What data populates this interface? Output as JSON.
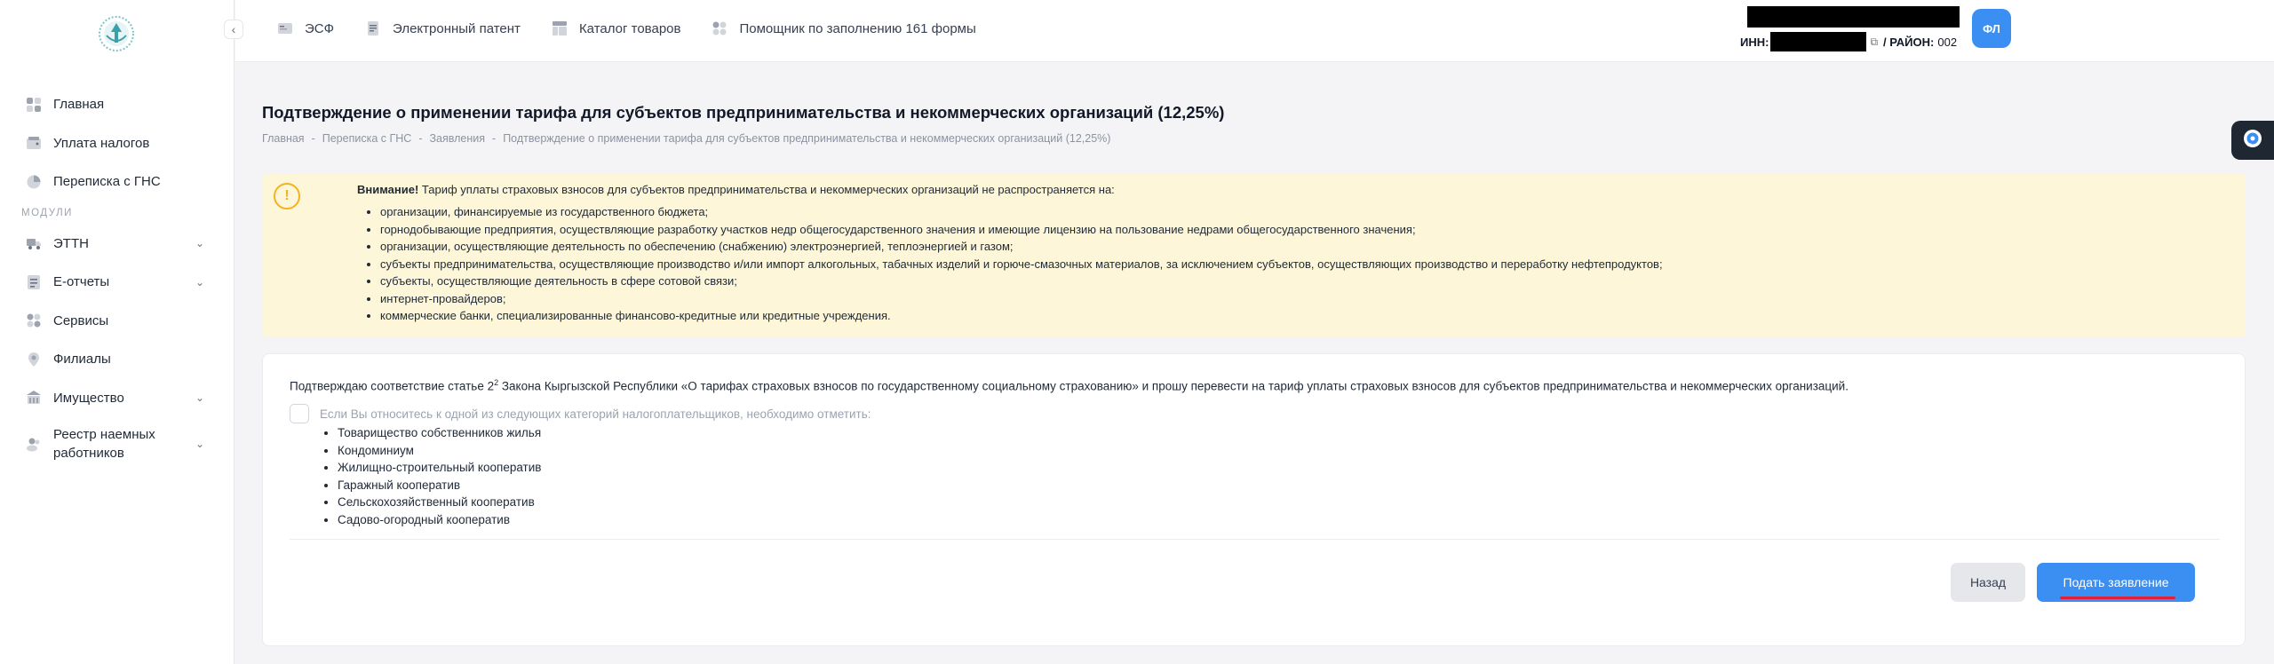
{
  "sidebar": {
    "collapse_glyph": "‹",
    "items": [
      {
        "label": "Главная",
        "icon": "home-icon"
      },
      {
        "label": "Уплата налогов",
        "icon": "wallet-icon"
      },
      {
        "label": "Переписка с ГНС",
        "icon": "chat-icon"
      }
    ],
    "section_label": "МОДУЛИ",
    "modules": [
      {
        "label": "ЭТТН",
        "icon": "truck-icon",
        "expandable": true
      },
      {
        "label": "Е-отчеты",
        "icon": "report-icon",
        "expandable": true
      },
      {
        "label": "Сервисы",
        "icon": "grid-icon",
        "expandable": false
      },
      {
        "label": "Филиалы",
        "icon": "pin-icon",
        "expandable": false
      },
      {
        "label": "Имущество",
        "icon": "building-icon",
        "expandable": true
      },
      {
        "label": "Реестр наемных работников",
        "icon": "people-icon",
        "expandable": true
      }
    ]
  },
  "topbar": {
    "links": [
      {
        "label": "ЭСФ",
        "icon": "invoice-icon"
      },
      {
        "label": "Электронный патент",
        "icon": "document-icon"
      },
      {
        "label": "Каталог товаров",
        "icon": "catalog-icon"
      },
      {
        "label": "Помощник по заполнению 161 формы",
        "icon": "helper-icon"
      }
    ],
    "inn_label": "ИНН:",
    "district_label": "/ РАЙОН:",
    "district_value": "002",
    "avatar_text": "ФЛ"
  },
  "page": {
    "title": "Подтверждение о применении тарифа для субъектов предпринимательства и некоммерческих организаций (12,25%)",
    "breadcrumb": [
      "Главная",
      "Переписка с ГНС",
      "Заявления",
      "Подтверждение о применении тарифа для субъектов предпринимательства и некоммерческих организаций (12,25%)"
    ],
    "breadcrumb_sep": "-"
  },
  "warning": {
    "bold": "Внимание!",
    "text": " Тариф уплаты страховых взносов для субъектов предпринимательства и некоммерческих организаций не распространяется на:",
    "items": [
      "организации, финансируемые из государственного бюджета;",
      "горнодобывающие предприятия, осуществляющие разработку участков недр общегосударственного значения и имеющие лицензию на пользование недрами общегосударственного значения;",
      "организации, осуществляющие деятельность по обеспечению (снабжению) электроэнергией, теплоэнергией и газом;",
      "субъекты предпринимательства, осуществляющие производство и/или импорт алкогольных, табачных изделий и горюче-смазочных материалов, за исключением субъектов, осуществляющих производство и переработку нефтепродуктов;",
      "субъекты, осуществляющие деятельность в сфере сотовой связи;",
      "интернет-провайдеров;",
      "коммерческие банки, специализированные финансово-кредитные или кредитные учреждения."
    ]
  },
  "form": {
    "statement_pre": "Подтверждаю соответствие статье 2",
    "statement_sup": "2",
    "statement_post": " Закона Кыргызской Республики «О тарифах страховых взносов по государственному социальному страхованию» и прошу перевести на тариф уплаты страховых взносов для субъектов предпринимательства и некоммерческих организаций.",
    "checkbox_label": "Если Вы относитесь к одной из следующих категорий налогоплательщиков, необходимо отметить:",
    "checkbox_checked": false,
    "categories": [
      "Товарищество собственников жилья",
      "Кондоминиум",
      "Жилищно-строительный кооператив",
      "Гаражный кооператив",
      "Сельскохозяйственный кооператив",
      "Садово-огородный кооператив"
    ],
    "back_label": "Назад",
    "submit_label": "Подать заявление"
  },
  "colors": {
    "accent": "#3b8ff3",
    "warning_bg": "#fdf6d8",
    "warning_icon": "#f2b320",
    "highlight_underline": "#e0203a"
  }
}
